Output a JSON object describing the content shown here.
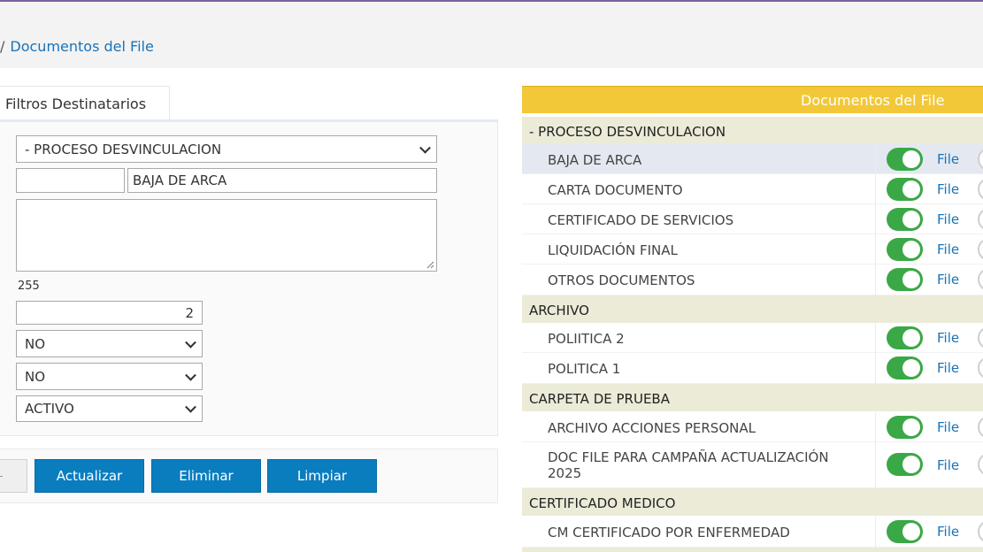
{
  "breadcrumb": {
    "separator": "/",
    "current": "Documentos del File"
  },
  "form": {
    "tab_label": "Filtros Destinatarios",
    "proceso_select": "- PROCESO DESVINCULACION",
    "code_input": "",
    "name_input": "BAJA DE ARCA",
    "description_textarea": "",
    "char_counter": "255",
    "order_input": "2",
    "select_1": "NO",
    "select_2": "NO",
    "status_select": "ACTIVO"
  },
  "buttons": {
    "actualizar": "Actualizar",
    "eliminar": "Eliminar",
    "limpiar": "Limpiar"
  },
  "documents_panel": {
    "title": "Documentos del File",
    "link_label": "File",
    "groups": [
      {
        "name": "- PROCESO DESVINCULACION",
        "items": [
          "BAJA DE ARCA",
          "CARTA DOCUMENTO",
          "CERTIFICADO DE SERVICIOS",
          "LIQUIDACIÓN FINAL",
          "OTROS DOCUMENTOS"
        ]
      },
      {
        "name": "ARCHIVO",
        "items": [
          "POLIITICA 2",
          "POLITICA 1"
        ]
      },
      {
        "name": "CARPETA DE PRUEBA",
        "items": [
          "ARCHIVO ACCIONES PERSONAL",
          "DOC FILE PARA CAMPAÑA ACTUALIZACIÓN 2025"
        ]
      },
      {
        "name": "CERTIFICADO MEDICO",
        "items": [
          "CM CERTIFICADO POR ENFERMEDAD"
        ]
      }
    ]
  },
  "colors": {
    "accent": "#0a7dbf",
    "panel_header": "#f2c838",
    "toggle_on": "#3aa846",
    "group_bg": "#ecebd8"
  }
}
